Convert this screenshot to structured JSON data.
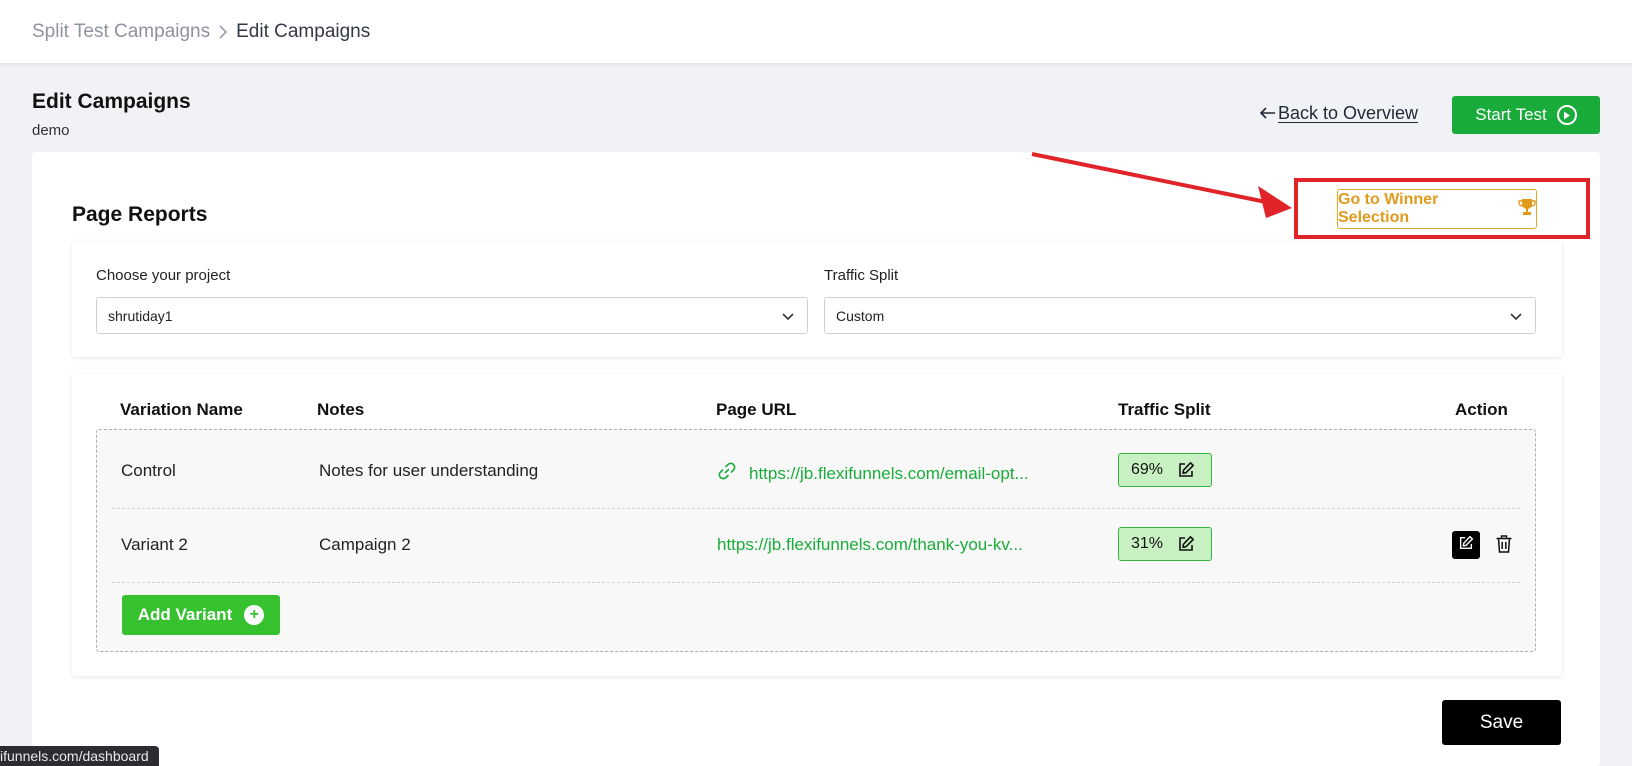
{
  "breadcrumb": {
    "root": "Split Test Campaigns",
    "current": "Edit Campaigns"
  },
  "header": {
    "title": "Edit Campaigns",
    "subtitle": "demo",
    "back_label": "Back to Overview",
    "start_label": "Start Test"
  },
  "reports": {
    "title": "Page Reports",
    "winner_label": "Go to Winner Selection"
  },
  "filters": {
    "project_label": "Choose your project",
    "project_value": "shrutiday1",
    "split_label": "Traffic Split",
    "split_value": "Custom"
  },
  "table": {
    "headers": [
      "Variation Name",
      "Notes",
      "Page URL",
      "Traffic Split",
      "Action"
    ],
    "rows": [
      {
        "name": "Control",
        "notes": "Notes for user understanding",
        "url": "https://jb.flexifunnels.com/email-opt...",
        "split": "69%"
      },
      {
        "name": "Variant 2",
        "notes": "Campaign 2",
        "url": "https://jb.flexifunnels.com/thank-you-kv...",
        "split": "31%"
      }
    ],
    "add_label": "Add Variant"
  },
  "footer": {
    "save_label": "Save"
  },
  "status_bar": {
    "url": "ifunnels.com/dashboard"
  },
  "colors": {
    "green": "#1aac3a",
    "orange": "#e09a1c",
    "annotation_red": "#e0242a"
  }
}
